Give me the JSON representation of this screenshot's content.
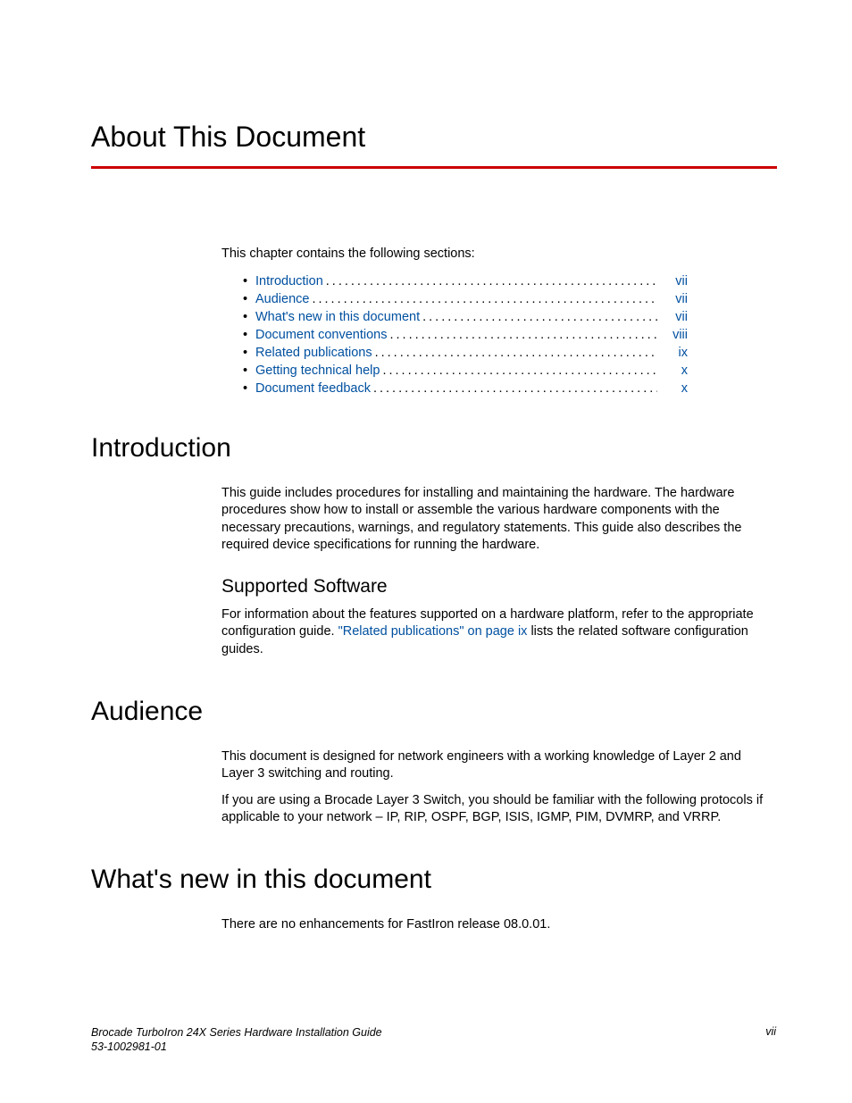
{
  "title": "About This Document",
  "intro_line": "This chapter contains the following sections:",
  "toc": [
    {
      "label": "Introduction",
      "page": "vii"
    },
    {
      "label": "Audience",
      "page": "vii"
    },
    {
      "label": "What's new in this document",
      "page": "vii"
    },
    {
      "label": "Document conventions",
      "page": "viii"
    },
    {
      "label": "Related publications",
      "page": "ix"
    },
    {
      "label": "Getting technical help",
      "page": "x"
    },
    {
      "label": "Document feedback",
      "page": "x"
    }
  ],
  "sections": {
    "introduction": {
      "heading": "Introduction",
      "body": "This guide includes procedures for installing and maintaining the hardware.  The hardware procedures show how to install or assemble the various hardware components with the necessary precautions, warnings, and regulatory statements. This guide also describes the required device specifications for running the hardware.",
      "sub_heading": "Supported Software",
      "sub_body_pre": "For information about the features supported on a hardware platform, refer to the appropriate configuration guide. ",
      "sub_body_link": "\"Related publications\" on page ix",
      "sub_body_post": " lists the related software configuration guides."
    },
    "audience": {
      "heading": "Audience",
      "p1": "This document is designed for network engineers with a working knowledge of Layer 2 and Layer 3 switching and routing.",
      "p2": "If you are using a Brocade Layer 3 Switch, you should be familiar with the following protocols if applicable to your network – IP, RIP, OSPF, BGP, ISIS, IGMP, PIM, DVMRP, and VRRP."
    },
    "whats_new": {
      "heading": "What's new in this document",
      "body": "There are no enhancements for FastIron release 08.0.01."
    }
  },
  "footer": {
    "line1": "Brocade TurboIron 24X Series Hardware Installation Guide",
    "line2": "53-1002981-01",
    "page_num": "vii"
  }
}
